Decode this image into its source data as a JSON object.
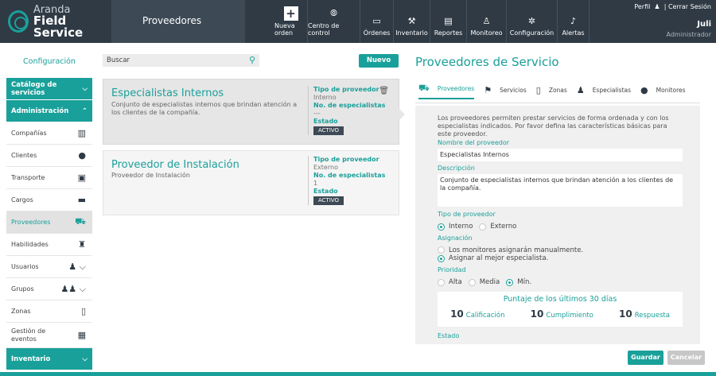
{
  "brand": {
    "line1": "Aranda",
    "line2": "Field Service"
  },
  "module_title": "Proveedores",
  "nav": [
    {
      "label": "Nueva orden",
      "icon": "plus-icon"
    },
    {
      "label": "Centro de control",
      "icon": "control-center-icon"
    },
    {
      "label": "Órdenes",
      "icon": "orders-icon"
    },
    {
      "label": "Inventario",
      "icon": "inventory-icon"
    },
    {
      "label": "Reportes",
      "icon": "reports-icon"
    },
    {
      "label": "Monitoreo",
      "icon": "monitoring-icon"
    },
    {
      "label": "Configuración",
      "icon": "gear-icon"
    },
    {
      "label": "Alertas",
      "icon": "bell-icon"
    }
  ],
  "user": {
    "profile": "Perfil",
    "separator": "|",
    "logout": "Cerrar Sesión",
    "name": "Juli",
    "role": "Administrador"
  },
  "sidebar": {
    "header": "Configuración",
    "sections": {
      "catalog": "Catálogo de servicios",
      "admin": "Administración",
      "inventory": "Inventario"
    },
    "items": [
      {
        "label": "Compañías",
        "icon": "building-icon"
      },
      {
        "label": "Clientes",
        "icon": "user-icon"
      },
      {
        "label": "Transporte",
        "icon": "bus-icon"
      },
      {
        "label": "Cargos",
        "icon": "briefcase-icon"
      },
      {
        "label": "Proveedores",
        "icon": "cart-icon"
      },
      {
        "label": "Habilidades",
        "icon": "person-walk-icon"
      },
      {
        "label": "Usuarios",
        "icon": "user-standing-icon"
      },
      {
        "label": "Grupos",
        "icon": "group-icon"
      },
      {
        "label": "Zonas",
        "icon": "map-icon"
      },
      {
        "label": "Gestión de eventos",
        "icon": "events-icon"
      }
    ]
  },
  "search": {
    "placeholder": "Buscar"
  },
  "new_button": "Nuevo",
  "cards": [
    {
      "title": "Especialistas Internos",
      "description": "Conjunto de especialistas internos que brindan atención a los clientes de la compañía.",
      "type_label": "Tipo de proveedor",
      "type_value": "Interno",
      "count_label": "No. de especialistas",
      "count_value": "---",
      "state_label": "Estado",
      "state_value": "ACTIVO"
    },
    {
      "title": "Proveedor de Instalación",
      "description": "Proveedor de Instalación",
      "type_label": "Tipo de proveedor",
      "type_value": "Externo",
      "count_label": "No. de especialistas",
      "count_value": "1",
      "state_label": "Estado",
      "state_value": "ACTIVO"
    }
  ],
  "panel": {
    "title": "Proveedores de Servicio",
    "tabs": [
      {
        "label": "Proveedores",
        "icon": "cart-icon"
      },
      {
        "label": "Servicios",
        "icon": "service-icon"
      },
      {
        "label": "Zonas",
        "icon": "map-icon"
      },
      {
        "label": "Especialistas",
        "icon": "user-standing-icon"
      },
      {
        "label": "Monitores",
        "icon": "user-icon"
      }
    ],
    "intro": "Los proveedores permiten prestar servicios de forma ordenada y con los especialistas indicados. Por favor defina las características básicas para este proveedor.",
    "name_label": "Nombre del proveedor",
    "name_value": "Especialistas Internos",
    "desc_label": "Descripción",
    "desc_value": "Conjunto de especialistas internos que brindan atención a los clientes de la compañía.",
    "type_label": "Tipo de proveedor",
    "type_options": [
      "Interno",
      "Externo"
    ],
    "assign_label": "Asignación",
    "assign_options": [
      "Los monitores asignarán manualmente.",
      "Asignar al mejor especialista."
    ],
    "priority_label": "Prioridad",
    "priority_options": [
      "Alta",
      "Media",
      "Mín."
    ],
    "score_title": "Puntaje de los últimos 30 días",
    "scores": [
      {
        "value": "10",
        "label": "Calificación"
      },
      {
        "value": "10",
        "label": "Cumplimiento"
      },
      {
        "value": "10",
        "label": "Respuesta"
      }
    ],
    "state_label": "Estado",
    "save": "Guardar",
    "cancel": "Cancelar"
  }
}
